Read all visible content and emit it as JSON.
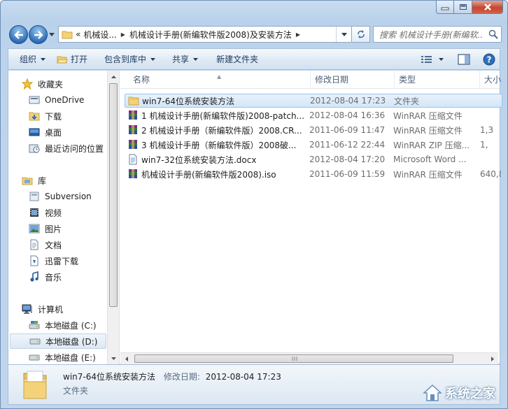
{
  "window": {
    "caption_buttons": [
      "minimize",
      "maximize",
      "close"
    ]
  },
  "address_bar": {
    "overflow": "«",
    "breadcrumbs": [
      "机械设...",
      "机械设计手册(新编软件版2008)及安装方法"
    ]
  },
  "search": {
    "placeholder": "搜索 机械设计手册(新编软..."
  },
  "toolbar": {
    "organize": "组织",
    "open": "打开",
    "include_in_library": "包含到库中",
    "share": "共享",
    "new_folder": "新建文件夹"
  },
  "nav": {
    "favorites": "收藏夹",
    "onedrive": "OneDrive",
    "downloads": "下载",
    "desktop": "桌面",
    "recent": "最近访问的位置",
    "libraries": "库",
    "subversion": "Subversion",
    "videos": "视频",
    "pictures": "图片",
    "documents": "文档",
    "xunlei": "迅雷下载",
    "music": "音乐",
    "computer": "计算机",
    "drive_c": "本地磁盘 (C:)",
    "drive_d": "本地磁盘 (D:)",
    "drive_e": "本地磁盘 (E:)"
  },
  "columns": {
    "name": "名称",
    "modified": "修改日期",
    "type": "类型",
    "size": "大小"
  },
  "files": [
    {
      "name": "win7-64位系统安装方法",
      "date": "2012-08-04 17:23",
      "type": "文件夹",
      "size": "",
      "icon": "folder-icon"
    },
    {
      "name": "1 机械设计手册(新编软件版)2008-patch...",
      "date": "2012-08-04 16:36",
      "type": "WinRAR 压缩文件",
      "size": "",
      "icon": "rar-archive-icon"
    },
    {
      "name": "2 机械设计手册（新编软件版）2008.CR...",
      "date": "2011-06-09 11:47",
      "type": "WinRAR 压缩文件",
      "size": "1,3",
      "icon": "rar-archive-icon"
    },
    {
      "name": "3 机械设计手册（新编软件版）2008破...",
      "date": "2011-06-12 22:44",
      "type": "WinRAR ZIP 压缩...",
      "size": "1,",
      "icon": "zip-archive-icon"
    },
    {
      "name": "win7-32位系统安装方法.docx",
      "date": "2012-08-04 17:20",
      "type": "Microsoft Word ...",
      "size": "",
      "icon": "word-document-icon"
    },
    {
      "name": "机械设计手册(新编软件版2008).iso",
      "date": "2011-06-09 11:59",
      "type": "WinRAR 压缩文件",
      "size": "640,8",
      "icon": "iso-archive-icon"
    }
  ],
  "details": {
    "name": "win7-64位系统安装方法",
    "modified_label": "修改日期:",
    "modified_value": "2012-08-04 17:23",
    "type": "文件夹"
  },
  "watermark": {
    "text": "系统之家"
  },
  "colors": {
    "selection": "#d5e6f8",
    "selection_border": "#9ec3ea",
    "chrome": "#bfd5ec",
    "close_button": "#c44630"
  }
}
